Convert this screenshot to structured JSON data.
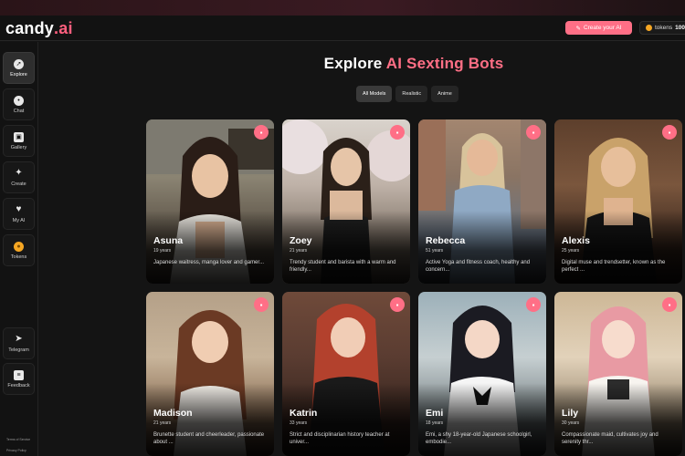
{
  "brand": {
    "name": "candy",
    "suffix": ".ai"
  },
  "header": {
    "create_label": "Create your AI",
    "tokens_label": "tokens",
    "tokens_count": "100"
  },
  "sidebar": {
    "items": [
      {
        "label": "Explore",
        "icon": "compass-icon"
      },
      {
        "label": "Chat",
        "icon": "chat-icon"
      },
      {
        "label": "Gallery",
        "icon": "gallery-icon"
      },
      {
        "label": "Create",
        "icon": "magic-wand-icon"
      },
      {
        "label": "My AI",
        "icon": "heart-icon"
      },
      {
        "label": "Tokens",
        "icon": "coin-icon"
      }
    ],
    "bottom_items": [
      {
        "label": "Telegram",
        "icon": "telegram-icon"
      },
      {
        "label": "Feedback",
        "icon": "feedback-icon"
      }
    ],
    "footer_links": [
      "Terms of Service",
      "Privacy Policy"
    ]
  },
  "main": {
    "title_plain": "Explore",
    "title_accent": "AI Sexting Bots",
    "filters": [
      "All Models",
      "Realistic",
      "Anime"
    ],
    "characters": [
      {
        "name": "Asuna",
        "age": "19 years",
        "desc": "Japanese waitress, manga lover and gamer..."
      },
      {
        "name": "Zoey",
        "age": "21 years",
        "desc": "Trendy student and barista with a warm and friendly..."
      },
      {
        "name": "Rebecca",
        "age": "51 years",
        "desc": "Active Yoga and fitness coach, healthy and concern..."
      },
      {
        "name": "Alexis",
        "age": "25 years",
        "desc": "Digital muse and trendsetter, known as the perfect ..."
      },
      {
        "name": "Madison",
        "age": "21 years",
        "desc": "Brunette student and cheerleader, passionate about ..."
      },
      {
        "name": "Katrin",
        "age": "33 years",
        "desc": "Strict and disciplinarian history teacher at univer..."
      },
      {
        "name": "Emi",
        "age": "18 years",
        "desc": "Emi, a shy 18-year-old Japanese schoolgirl, embodie..."
      },
      {
        "name": "Lily",
        "age": "30 years",
        "desc": "Compassionate maid, cultivates joy and serenity thr..."
      }
    ]
  },
  "colors": {
    "accent": "#ff6f86",
    "background": "#141414",
    "coin": "#f5a623"
  }
}
